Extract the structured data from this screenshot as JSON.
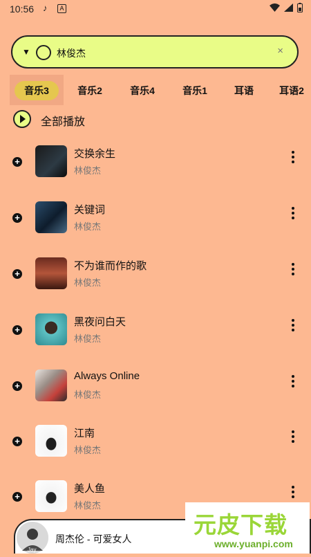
{
  "status": {
    "time": "10:56"
  },
  "search": {
    "query": "林俊杰"
  },
  "tabs": [
    "音乐3",
    "音乐2",
    "音乐4",
    "音乐1",
    "耳语",
    "耳语2"
  ],
  "play_all": "全部播放",
  "songs": [
    {
      "title": "交换余生",
      "artist": "林俊杰"
    },
    {
      "title": "关键词",
      "artist": "林俊杰"
    },
    {
      "title": "不为谁而作的歌",
      "artist": "林俊杰"
    },
    {
      "title": "黑夜问白天",
      "artist": "林俊杰"
    },
    {
      "title": "Always Online",
      "artist": "林俊杰"
    },
    {
      "title": "江南",
      "artist": "林俊杰"
    },
    {
      "title": "美人鱼",
      "artist": "林俊杰"
    }
  ],
  "now_playing": {
    "text": "周杰伦 - 可爱女人",
    "avatar_text": "Jay"
  },
  "watermark": {
    "brand": "元皮下载",
    "url": "www.yuanpi.com"
  }
}
